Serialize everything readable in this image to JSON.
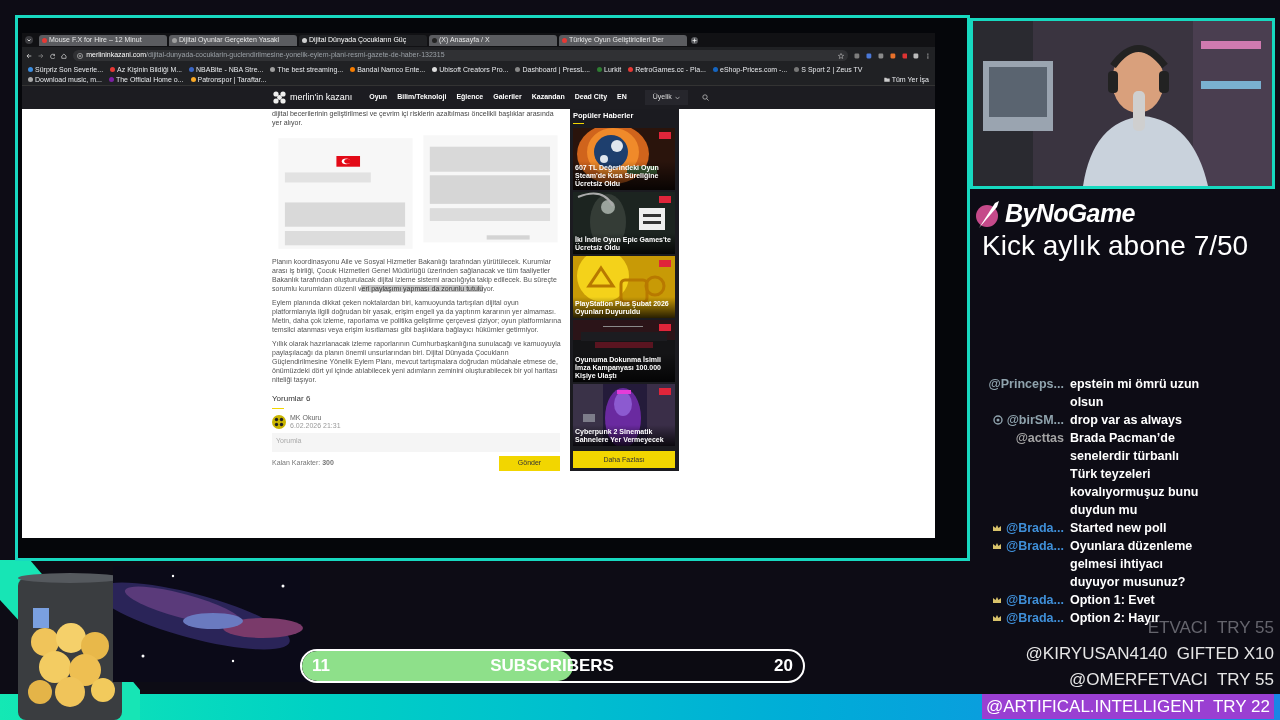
{
  "browser": {
    "tabs": [
      {
        "title": "Mouse F.X for Hire – 12 Minut",
        "selected": false
      },
      {
        "title": "Dijital Oyunlar Gerçekten Yasakl",
        "selected": false
      },
      {
        "title": "Dijital Dünyada Çocukların Güç",
        "selected": true
      },
      {
        "title": "(X) Anasayfa / X",
        "selected": false
      },
      {
        "title": "Türkiye Oyun Geliştiricileri Der",
        "selected": false
      }
    ],
    "url_host": "merlininkazani.com",
    "url_path": "/dijital-dunyada-cocuklarin-guclendirilmesine-yonelik-eylem-plani-resmi-gazete-de-haber-132315",
    "bookmarks": [
      "Sürpriz Son Severle...",
      "Az Kişinin Bildiği M...",
      "NBABite - NBA Stre...",
      "The best streaming...",
      "Bandai Namco Ente...",
      "Ubisoft Creators Pro...",
      "Dashboard | PressL...",
      "Lurkit",
      "RetroGames.cc - Pla...",
      "eShop-Prices.com -...",
      "S Sport 2 | Zeus TV",
      "Download music, m...",
      "The Official Home o...",
      "Patronspor | Taraftar..."
    ],
    "all_bookmarks": "Tüm Yer İşa"
  },
  "site": {
    "logo": "merlin'in kazanı",
    "nav": [
      "Oyun",
      "Bilim/Teknoloji",
      "Eğlence",
      "Galeriler",
      "Kazandan",
      "Dead City",
      "EN"
    ],
    "membership": "Üyelik"
  },
  "article": {
    "lead_line": "dijital becerilerinin geliştirilmesi ve çevrim içi risklerin azaltılması öncelikli başlıklar arasında yer alıyor.",
    "paragraphs": [
      [
        {
          "text": "Planın koordinasyonu Aile ve Sosyal Hizmetler Bakanlığı tarafından yürütülecek. Kurumlar arası iş birliği, Çocuk Hizmetleri Genel Müdürlüğü üzerinden sağlanacak ve tüm faaliyetler Bakanlık tarafından oluşturulacak dijital izleme sistemi aracılığıyla takip edilecek. Bu süreçte sorumlu kurumların düzenli v",
          "selected": false
        },
        {
          "text": "eri paylaşımı yapması da zorunlu tutulu",
          "selected": true
        },
        {
          "text": "yor.",
          "selected": false
        }
      ],
      [
        {
          "text": "Eylem planında dikkat çeken noktalardan biri, kamuoyunda tartışılan dijital oyun platformlarıyla ilgili doğrudan bir yasak, erişim engeli ya da yaptırım kararının yer almaması. Metin, daha çok izleme, raporlama ve politika geliştirme çerçevesi çiziyor; oyun platformlarına temsilci atanması veya erişim kısıtlaması gibi başlıklara bağlayıcı hükümler getirmiyor.",
          "selected": false
        }
      ],
      [
        {
          "text": "Yıllık olarak hazırlanacak izleme raporlarının Cumhurbaşkanlığına sunulacağı ve kamuoyuyla paylaşılacağı da planın önemli unsurlarından biri. Dijital Dünyada Çocukların Güçlendirilmesine Yönelik Eylem Planı, mevcut tartışmalara doğrudan müdahale etmese de, önümüzdeki dört yıl içinde atılabilecek yeni adımların zeminini oluşturabilecek bir yol haritası niteliği taşıyor.",
          "selected": false
        }
      ]
    ]
  },
  "comments": {
    "title": "Yorumlar 6",
    "author": "MK Okuru",
    "date": "6.02.2026 21:31",
    "placeholder": "Yorumla",
    "remaining": "Kalan Karakter: **300**",
    "submit": "Gönder"
  },
  "sidebar": {
    "title": "Popüler Haberler",
    "items": [
      {
        "title": "607 TL Değerindeki Oyun Steam'de Kısa Süreliğine Ücretsiz Oldu"
      },
      {
        "title": "İki İndie Oyun Epic Games'te Ücretsiz Oldu"
      },
      {
        "title": "PlayStation Plus Şubat 2026 Oyunları Duyuruldu"
      },
      {
        "title": "Oyunuma Dokunma İsimli İmza Kampanyası 100.000 Kişiye Ulaştı"
      },
      {
        "title": "Cyberpunk 2 Sinematik Sahnelere Yer Vermeyecek"
      }
    ],
    "more": "Daha Fazlası"
  },
  "overlay": {
    "brand": "ByNoGame",
    "goal": "Kick aylık abone 7/50",
    "chat": [
      {
        "user": "@Princeps...",
        "kind": "plain",
        "color": "#8fa3ad",
        "message": "epstein mi ömrü uzun olsun"
      },
      {
        "user": "@birSM...",
        "kind": "coin",
        "color": "#8fa3ad",
        "message": "drop var as always"
      },
      {
        "user": "@acttas",
        "kind": "plain",
        "color": "#a3a3a3",
        "message": "Brada Pacman’de senelerdir türbanlı Türk teyzeleri kovalıyormuşuz bunu duydun mu"
      },
      {
        "user": "@Brada...",
        "kind": "crown",
        "color": "#3f8fd8",
        "message": "Started new poll"
      },
      {
        "user": "@Brada...",
        "kind": "crown",
        "color": "#3f8fd8",
        "message": "Oyunlara düzenleme gelmesi ihtiyacı duyuyor musunuz?"
      },
      {
        "user": "@Brada...",
        "kind": "crown",
        "color": "#3f8fd8",
        "message": "Option 1: Evet"
      },
      {
        "user": "@Brada...",
        "kind": "crown",
        "color": "#3f8fd8",
        "message": "Option 2: Hayır"
      }
    ],
    "alerts": [
      {
        "kind": "faint",
        "text": "ETVACI  TRY 55"
      },
      {
        "kind": "plain",
        "text": "@KIRYUSAN4140  GIFTED X10"
      },
      {
        "kind": "plain",
        "text": "@OMERFETVACI  TRY 55"
      },
      {
        "kind": "highlight",
        "text": "@ARTIFICAL.INTELLIGENT  TRY 22"
      }
    ]
  },
  "subs": {
    "current": "11",
    "label": "SUBSCRIBERS",
    "goal": "20",
    "level": 0.54
  }
}
